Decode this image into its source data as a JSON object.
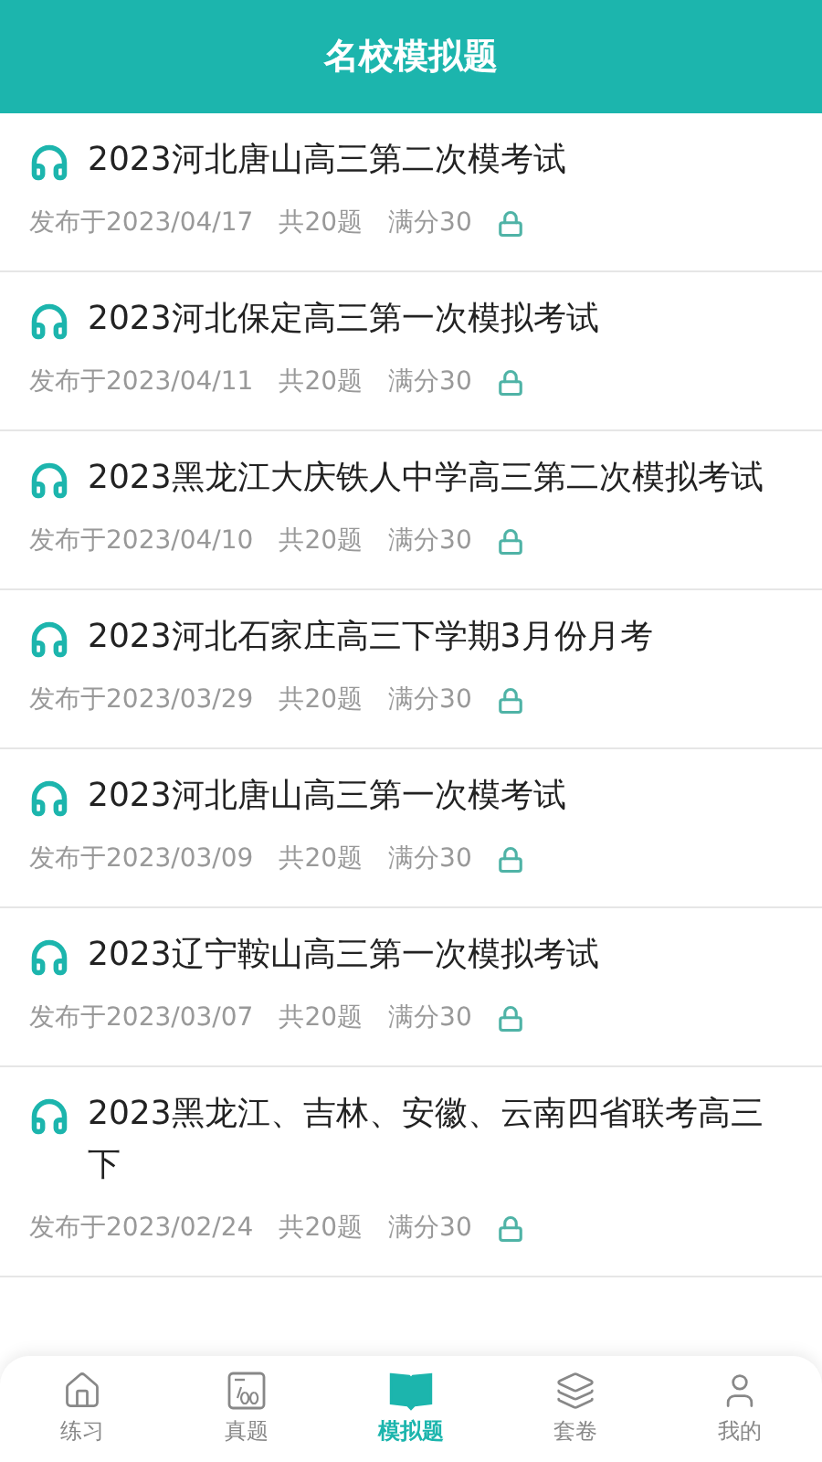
{
  "header": {
    "title": "名校模拟题"
  },
  "papers": [
    {
      "title": "2023河北唐山高三第二次模考试",
      "published": "发布于2023/04/17",
      "count": "共20题",
      "score": "满分30",
      "locked": true
    },
    {
      "title": "2023河北保定高三第一次模拟考试",
      "published": "发布于2023/04/11",
      "count": "共20题",
      "score": "满分30",
      "locked": true
    },
    {
      "title": "2023黑龙江大庆铁人中学高三第二次模拟考试",
      "published": "发布于2023/04/10",
      "count": "共20题",
      "score": "满分30",
      "locked": true
    },
    {
      "title": "2023河北石家庄高三下学期3月份月考",
      "published": "发布于2023/03/29",
      "count": "共20题",
      "score": "满分30",
      "locked": true
    },
    {
      "title": "2023河北唐山高三第一次模考试",
      "published": "发布于2023/03/09",
      "count": "共20题",
      "score": "满分30",
      "locked": true
    },
    {
      "title": "2023辽宁鞍山高三第一次模拟考试",
      "published": "发布于2023/03/07",
      "count": "共20题",
      "score": "满分30",
      "locked": true
    },
    {
      "title": "2023黑龙江、吉林、安徽、云南四省联考高三下",
      "published": "发布于2023/02/24",
      "count": "共20题",
      "score": "满分30",
      "locked": true
    }
  ],
  "tabs": [
    {
      "label": "练习",
      "kind": "home",
      "selected": false
    },
    {
      "label": "真题",
      "kind": "score",
      "selected": false
    },
    {
      "label": "模拟题",
      "kind": "book",
      "selected": true
    },
    {
      "label": "套卷",
      "kind": "layers",
      "selected": false
    },
    {
      "label": "我的",
      "kind": "user",
      "selected": false
    }
  ]
}
